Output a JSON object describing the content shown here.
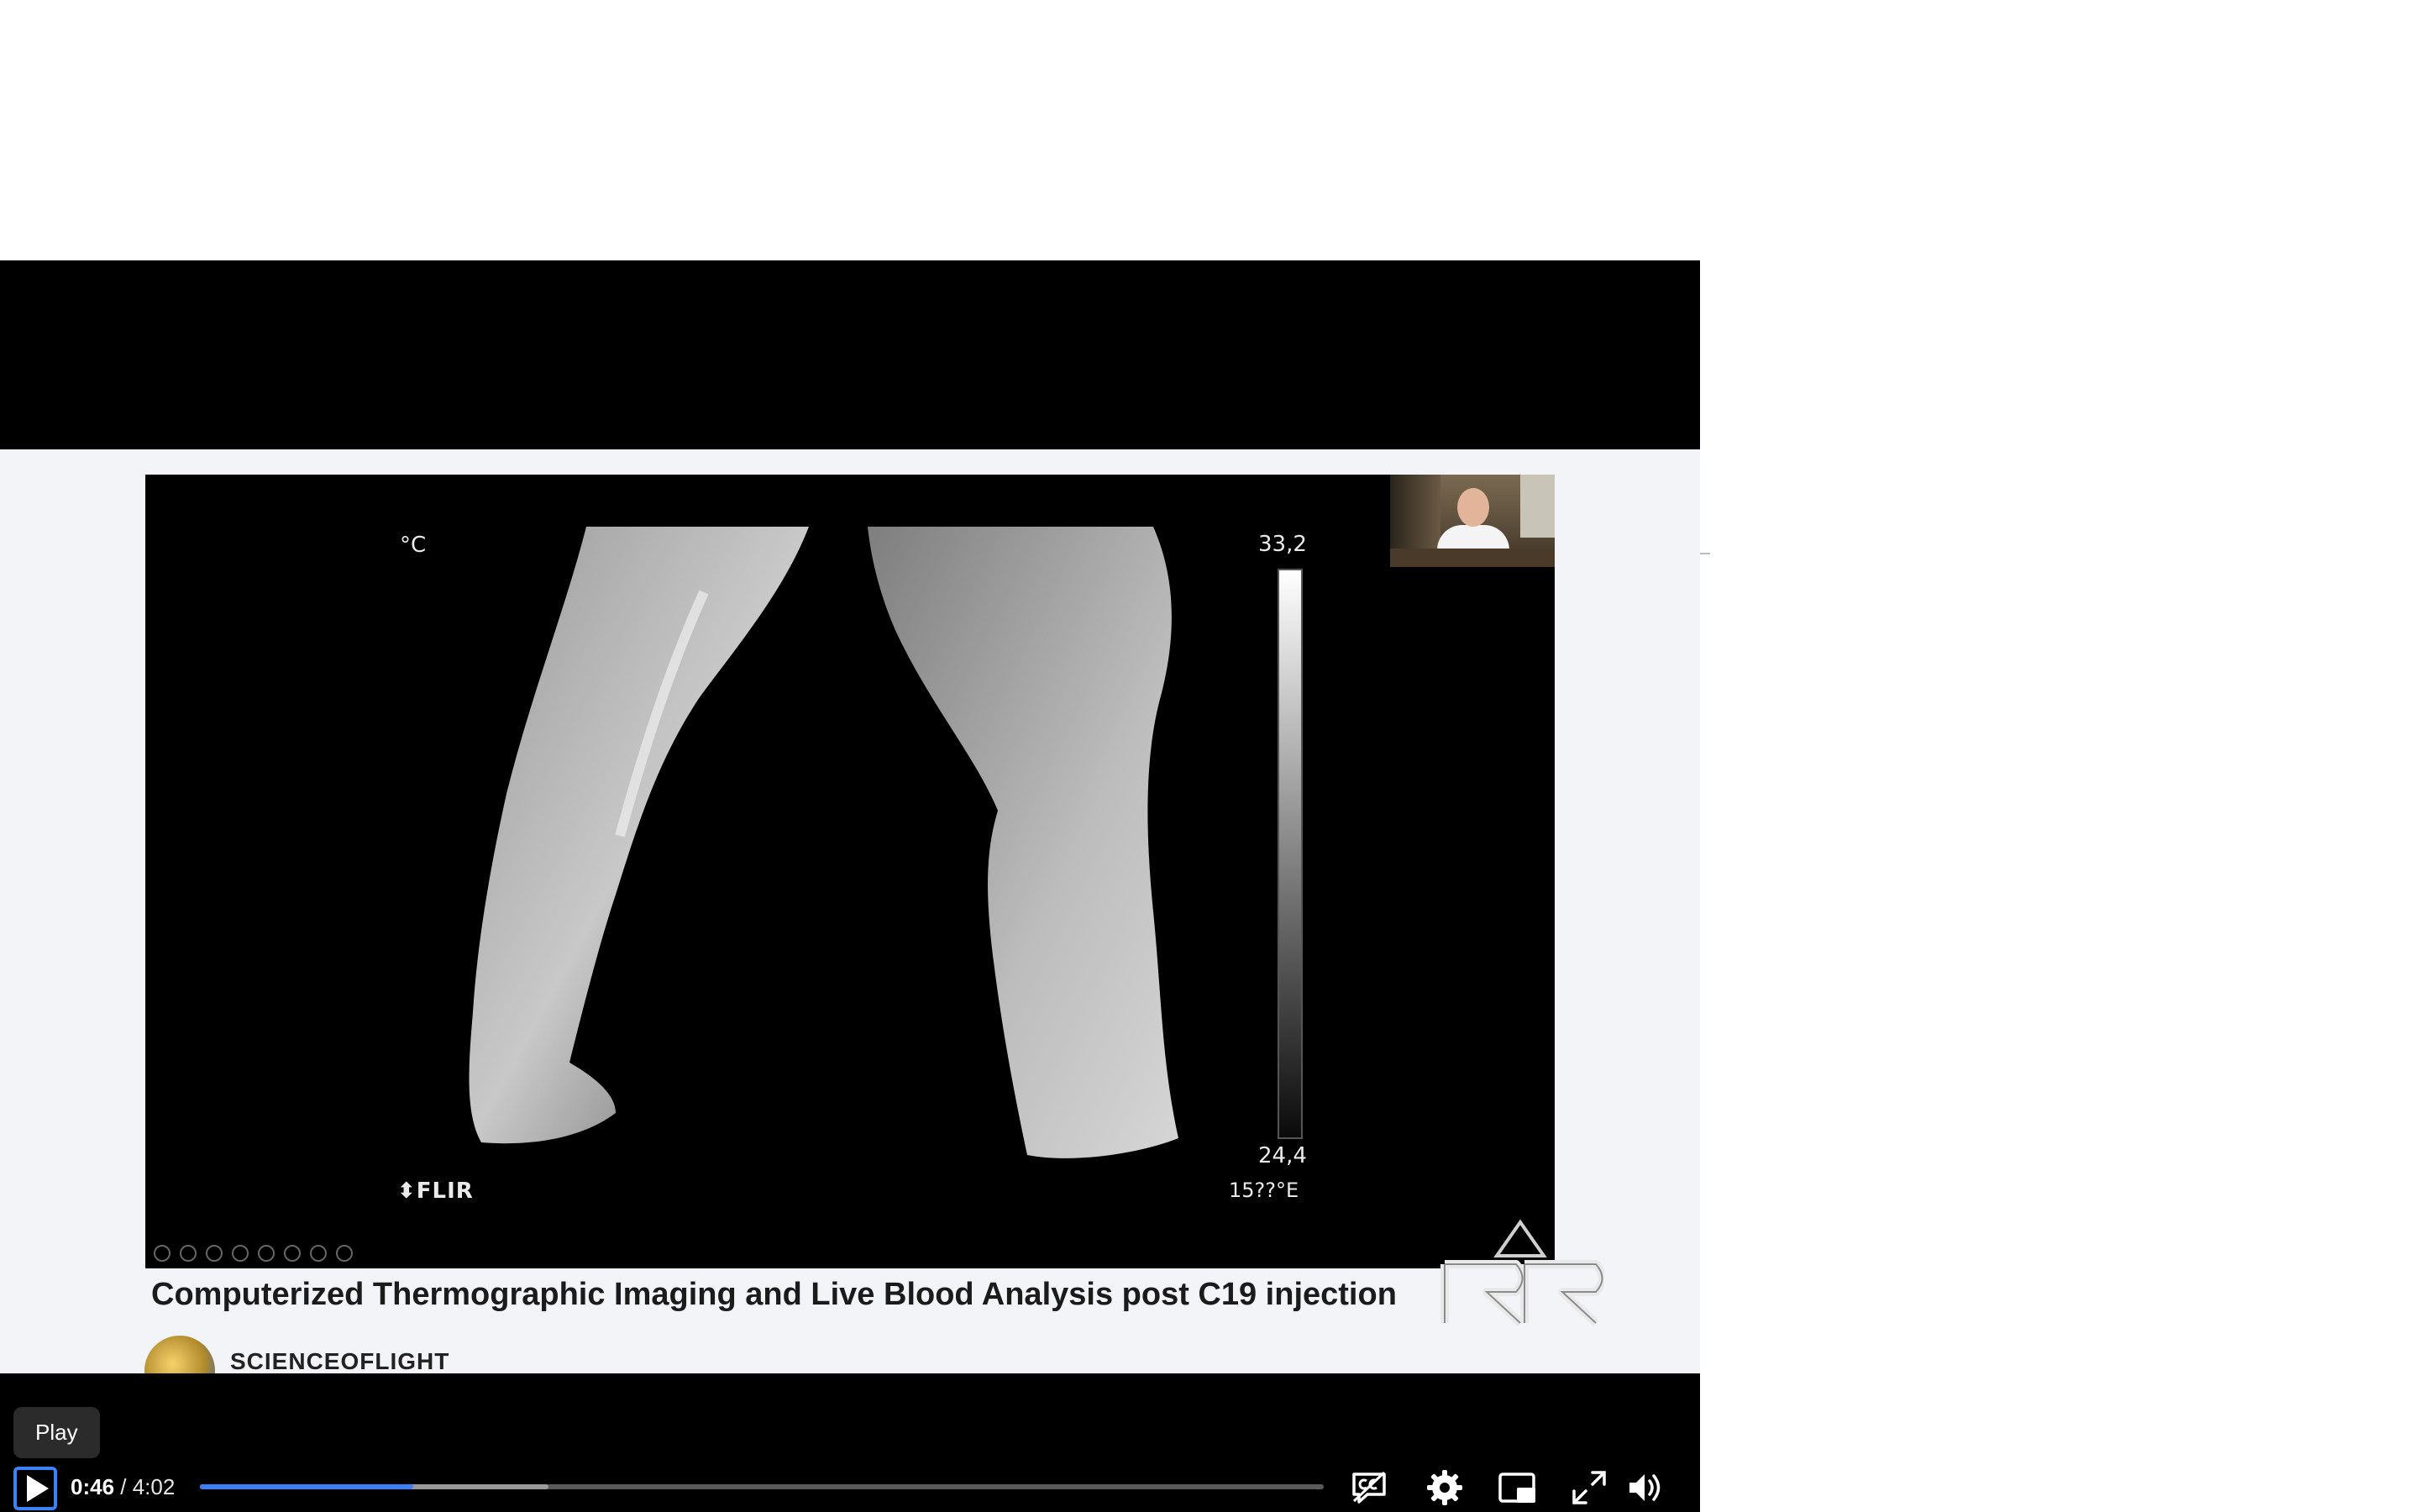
{
  "video": {
    "title": "Computerized Thermographic Imaging and Live Blood Analysis post C19 injection",
    "channel": "SCIENCEOFLIGHT"
  },
  "slide": {
    "unit_label": "°C",
    "scale_max": "33,2",
    "scale_min": "24,4",
    "temp_reading": "15??°E",
    "brand": "FLIR"
  },
  "player": {
    "tooltip": "Play",
    "time_current": "0:46",
    "time_separator": " / ",
    "time_total": "4:02",
    "progress_played_fraction": 0.19,
    "progress_buffered_fraction": 0.31,
    "accent_color": "#3b82f6"
  },
  "icons": {
    "play": "play-icon",
    "captions": "captions-icon",
    "settings": "gear-icon",
    "pip": "picture-in-picture-icon",
    "fullscreen": "fullscreen-icon",
    "volume": "volume-icon"
  }
}
